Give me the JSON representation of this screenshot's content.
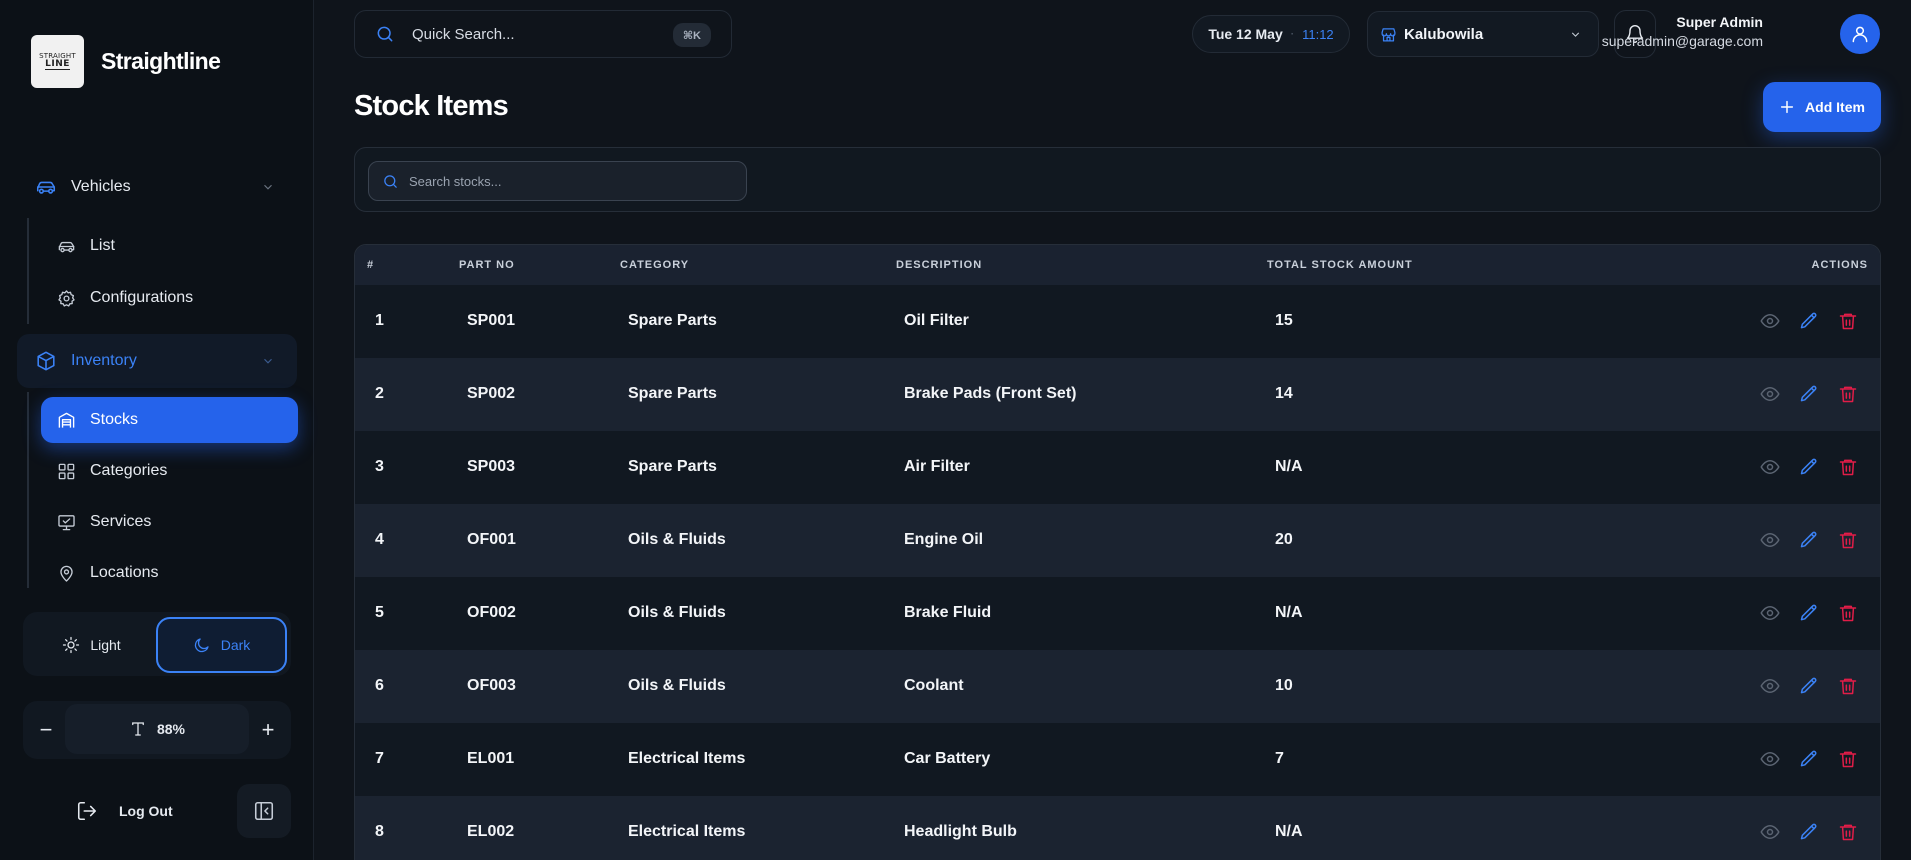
{
  "brand": {
    "logo_line1": "STRAIGHT",
    "logo_line2": "LINE",
    "name": "Straightline"
  },
  "sidebar": {
    "vehicles": {
      "label": "Vehicles",
      "icon": "car-icon",
      "items": [
        {
          "label": "List",
          "icon": "car-icon"
        },
        {
          "label": "Configurations",
          "icon": "gear-icon"
        }
      ]
    },
    "inventory": {
      "label": "Inventory",
      "icon": "cube-icon",
      "items": [
        {
          "label": "Stocks",
          "icon": "warehouse-icon",
          "active": true
        },
        {
          "label": "Categories",
          "icon": "grid-icon"
        },
        {
          "label": "Services",
          "icon": "monitor-icon"
        },
        {
          "label": "Locations",
          "icon": "map-pin-icon"
        }
      ]
    },
    "theme": {
      "light": "Light",
      "dark": "Dark",
      "selected": "Dark"
    },
    "font_size": {
      "minus": "−",
      "value": "88%",
      "plus": "+"
    },
    "logout": "Log Out"
  },
  "topbar": {
    "search_placeholder": "Quick Search...",
    "shortcut": "⌘K",
    "date": "Tue 12 May",
    "dot": "·",
    "time": "11:12",
    "branch": "Kalubowila",
    "user_name": "Super Admin",
    "user_email": "superadmin@garage.com"
  },
  "page": {
    "title": "Stock Items",
    "add_button": "Add Item",
    "search_placeholder": "Search stocks..."
  },
  "table": {
    "columns": [
      "#",
      "PART NO",
      "CATEGORY",
      "DESCRIPTION",
      "TOTAL STOCK AMOUNT",
      "ACTIONS"
    ],
    "rows": [
      {
        "n": "1",
        "part": "SP001",
        "cat": "Spare Parts",
        "desc": "Oil Filter",
        "total": "15"
      },
      {
        "n": "2",
        "part": "SP002",
        "cat": "Spare Parts",
        "desc": "Brake Pads (Front Set)",
        "total": "14"
      },
      {
        "n": "3",
        "part": "SP003",
        "cat": "Spare Parts",
        "desc": "Air Filter",
        "total": "N/A"
      },
      {
        "n": "4",
        "part": "OF001",
        "cat": "Oils & Fluids",
        "desc": "Engine Oil",
        "total": "20"
      },
      {
        "n": "5",
        "part": "OF002",
        "cat": "Oils & Fluids",
        "desc": "Brake Fluid",
        "total": "N/A"
      },
      {
        "n": "6",
        "part": "OF003",
        "cat": "Oils & Fluids",
        "desc": "Coolant",
        "total": "10"
      },
      {
        "n": "7",
        "part": "EL001",
        "cat": "Electrical Items",
        "desc": "Car Battery",
        "total": "7"
      },
      {
        "n": "8",
        "part": "EL002",
        "cat": "Electrical Items",
        "desc": "Headlight Bulb",
        "total": "N/A"
      }
    ]
  },
  "colors": {
    "accent": "#2563eb",
    "delete": "#e11d48",
    "edit": "#3b82f6",
    "view": "#5b6472",
    "background": "#0f141b"
  }
}
